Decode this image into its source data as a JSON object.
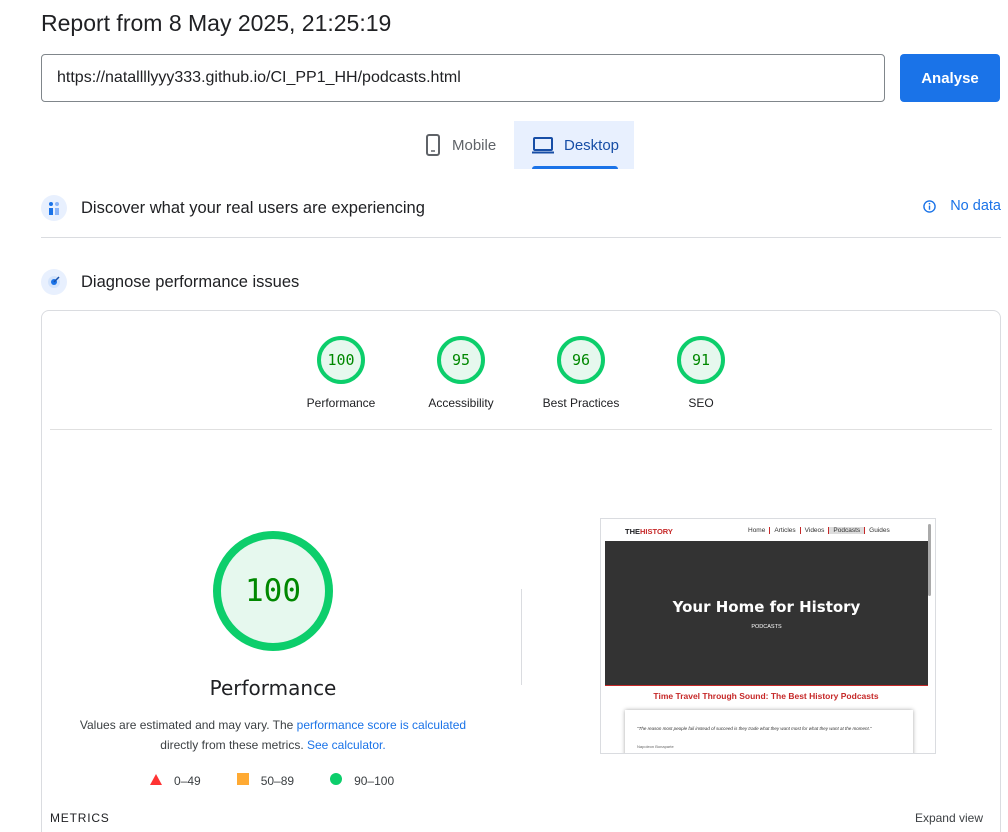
{
  "header": {
    "title": "Report from 8 May 2025, 21:25:19"
  },
  "url_input": {
    "value": "https://natallllyyy333.github.io/CI_PP1_HH/podcasts.html"
  },
  "analyse_button": {
    "label": "Analyse"
  },
  "tabs": {
    "mobile": "Mobile",
    "desktop": "Desktop",
    "selected": "Desktop"
  },
  "crux": {
    "title": "Discover what your real users are experiencing",
    "status": "No data"
  },
  "diagnose": {
    "title": "Diagnose performance issues"
  },
  "scores": [
    {
      "value": "100",
      "label": "Performance"
    },
    {
      "value": "95",
      "label": "Accessibility"
    },
    {
      "value": "96",
      "label": "Best Practices"
    },
    {
      "value": "91",
      "label": "SEO"
    }
  ],
  "main_gauge": {
    "value": "100",
    "label": "Performance"
  },
  "note": {
    "text_1": "Values are estimated and may vary. The ",
    "link_1": "performance score is calculated",
    "text_2": "directly from these metrics. ",
    "link_2": "See calculator."
  },
  "legend": [
    {
      "range": "0–49",
      "color": "#ff3333",
      "shape": "triangle"
    },
    {
      "range": "50–89",
      "color": "#ffaa33",
      "shape": "square"
    },
    {
      "range": "90–100",
      "color": "#0cce6b",
      "shape": "circle"
    }
  ],
  "screenshot": {
    "logo_prefix": "THE",
    "logo_highlight": "HISTORY",
    "nav": [
      "Home",
      "Articles",
      "Videos",
      "Podcasts",
      "Guides"
    ],
    "hero_title": "Your Home for History",
    "hero_subtitle": "PODCASTS",
    "section_heading": "Time Travel Through Sound: The Best History Podcasts",
    "quote": "\"The reason most people fail instead of succeed is they trade what they want most for what they want at the moment.\"",
    "quote_author": "Napoleon Bonaparte"
  },
  "metrics": {
    "label": "METRICS",
    "expand": "Expand view"
  },
  "colors": {
    "accent": "#1a73e8",
    "pass": "#0cce6b",
    "pass_text": "#008800"
  }
}
